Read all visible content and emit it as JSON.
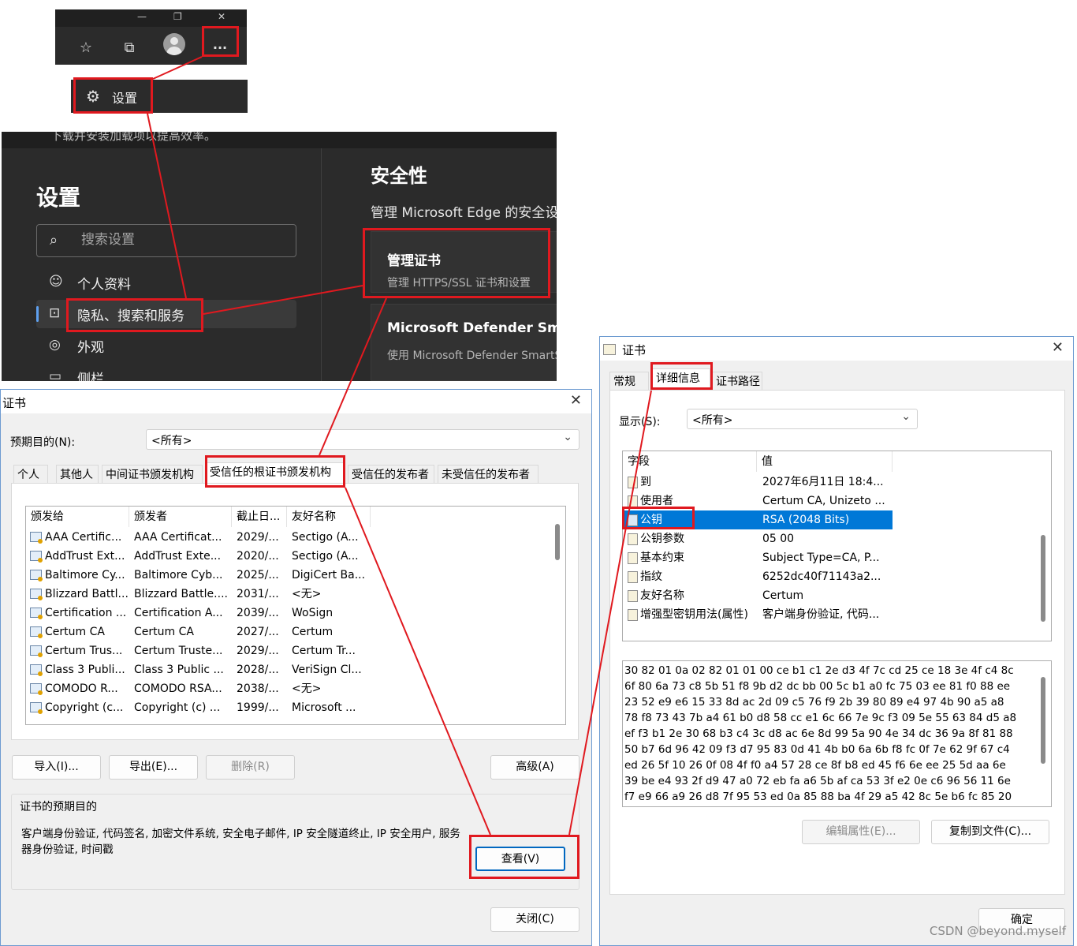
{
  "edge_toolbar": {
    "caption_min": "—",
    "caption_max": "❐",
    "caption_close": "✕",
    "icons": [
      "favorites-icon",
      "collections-icon",
      "profile-icon",
      "more-icon"
    ],
    "more_glyph": "···",
    "menu_settings_label": "设置"
  },
  "edge_settings": {
    "top_banner": "下载并安装加载项以提高效率。",
    "title": "设置",
    "search_placeholder": "搜索设置",
    "nav": [
      {
        "label": "个人资料",
        "icon": "profile-icon",
        "glyph": "☺"
      },
      {
        "label": "隐私、搜索和服务",
        "icon": "lock-icon",
        "glyph": "🔒"
      },
      {
        "label": "外观",
        "icon": "palette-icon",
        "glyph": "◎"
      },
      {
        "label": "侧栏",
        "icon": "sidebar-icon",
        "glyph": "▭"
      }
    ],
    "section_title": "安全性",
    "section_subtitle": "管理 Microsoft Edge 的安全设置",
    "cards": [
      {
        "title": "管理证书",
        "subtitle": "管理 HTTPS/SSL 证书和设置"
      },
      {
        "title": "Microsoft Defender SmartScreen",
        "subtitle": "使用 Microsoft Defender SmartScreen"
      }
    ]
  },
  "cert_manager": {
    "title": "证书",
    "close_glyph": "✕",
    "purpose_label": "预期目的(N):",
    "purpose_value": "<所有>",
    "tabs": [
      "个人",
      "其他人",
      "中间证书颁发机构",
      "受信任的根证书颁发机构",
      "受信任的发布者",
      "未受信任的发布者"
    ],
    "selected_tab": "受信任的根证书颁发机构",
    "columns": [
      "颁发给",
      "颁发者",
      "截止日...",
      "友好名称"
    ],
    "rows": [
      [
        "AAA Certific...",
        "AAA Certificat...",
        "2029/...",
        "Sectigo (A..."
      ],
      [
        "AddTrust Ext...",
        "AddTrust Exte...",
        "2020/...",
        "Sectigo (A..."
      ],
      [
        "Baltimore Cy...",
        "Baltimore Cyb...",
        "2025/...",
        "DigiCert Ba..."
      ],
      [
        "Blizzard Battl...",
        "Blizzard Battle....",
        "2031/...",
        "<无>"
      ],
      [
        "Certification ...",
        "Certification A...",
        "2039/...",
        "WoSign"
      ],
      [
        "Certum CA",
        "Certum CA",
        "2027/...",
        "Certum"
      ],
      [
        "Certum Trus...",
        "Certum Truste...",
        "2029/...",
        "Certum Tr..."
      ],
      [
        "Class 3 Publi...",
        "Class 3 Public ...",
        "2028/...",
        "VeriSign Cl..."
      ],
      [
        "COMODO R...",
        "COMODO RSA...",
        "2038/...",
        "<无>"
      ],
      [
        "Copyright (c...",
        "Copyright (c) ...",
        "1999/...",
        "Microsoft ..."
      ]
    ],
    "buttons": {
      "import": "导入(I)...",
      "export": "导出(E)...",
      "remove": "删除(R)",
      "advanced": "高级(A)",
      "view": "查看(V)",
      "close": "关闭(C)"
    },
    "purposes_group_label": "证书的预期目的",
    "purposes_text": "客户端身份验证, 代码签名, 加密文件系统, 安全电子邮件, IP 安全隧道终止, IP 安全用户, 服务器身份验证, 时间戳"
  },
  "cert_detail": {
    "title": "证书",
    "close_glyph": "✕",
    "tabs": [
      "常规",
      "详细信息",
      "证书路径"
    ],
    "selected_tab": "详细信息",
    "show_label": "显示(S):",
    "show_value": "<所有>",
    "columns": [
      "字段",
      "值"
    ],
    "fields": [
      {
        "name": "到",
        "value": "2027年6月11日 18:4...",
        "icon": "field-icon"
      },
      {
        "name": "使用者",
        "value": "Certum CA, Unizeto ...",
        "icon": "field-icon"
      },
      {
        "name": "公钥",
        "value": "RSA (2048 Bits)",
        "icon": "key-field-icon",
        "selected": true
      },
      {
        "name": "公钥参数",
        "value": "05 00",
        "icon": "field-icon"
      },
      {
        "name": "基本约束",
        "value": "Subject Type=CA, P...",
        "icon": "extension-icon"
      },
      {
        "name": "指纹",
        "value": "6252dc40f71143a2...",
        "icon": "property-icon"
      },
      {
        "name": "友好名称",
        "value": "Certum",
        "icon": "property-icon"
      },
      {
        "name": "增强型密钥用法(属性)",
        "value": "客户端身份验证, 代码...",
        "icon": "property-icon"
      }
    ],
    "hex_lines": [
      "30 82 01 0a 02 82 01 01 00 ce b1 c1 2e d3 4f 7c cd 25 ce 18 3e 4f c4 8c",
      "6f 80 6a 73 c8 5b 51 f8 9b d2 dc bb 00 5c b1 a0 fc 75 03 ee 81 f0 88 ee",
      "23 52 e9 e6 15 33 8d ac 2d 09 c5 76 f9 2b 39 80 89 e4 97 4b 90 a5 a8",
      "78 f8 73 43 7b a4 61 b0 d8 58 cc e1 6c 66 7e 9c f3 09 5e 55 63 84 d5 a8",
      "ef f3 b1 2e 30 68 b3 c4 3c d8 ac 6e 8d 99 5a 90 4e 34 dc 36 9a 8f 81 88",
      "50 b7 6d 96 42 09 f3 d7 95 83 0d 41 4b b0 6a 6b f8 fc 0f 7e 62 9f 67 c4",
      "ed 26 5f 10 26 0f 08 4f f0 a4 57 28 ce 8f b8 ed 45 f6 6e ee 25 5d aa 6e",
      "39 be e4 93 2f d9 47 a0 72 eb fa a6 5b af ca 53 3f e2 0e c6 96 56 11 6e",
      "f7 e9 66 a9 26 d8 7f 95 53 ed 0a 85 88 ba 4f 29 a5 42 8c 5e b6 fc 85 20"
    ],
    "buttons": {
      "edit": "编辑属性(E)...",
      "copy": "复制到文件(C)...",
      "ok": "确定"
    }
  },
  "watermark": "CSDN @beyond.myself",
  "colors": {
    "annotation": "#e0191f",
    "selection": "#0078d7",
    "edge_dark": "#2b2b2b",
    "edge_accent": "#5ea0ef"
  }
}
